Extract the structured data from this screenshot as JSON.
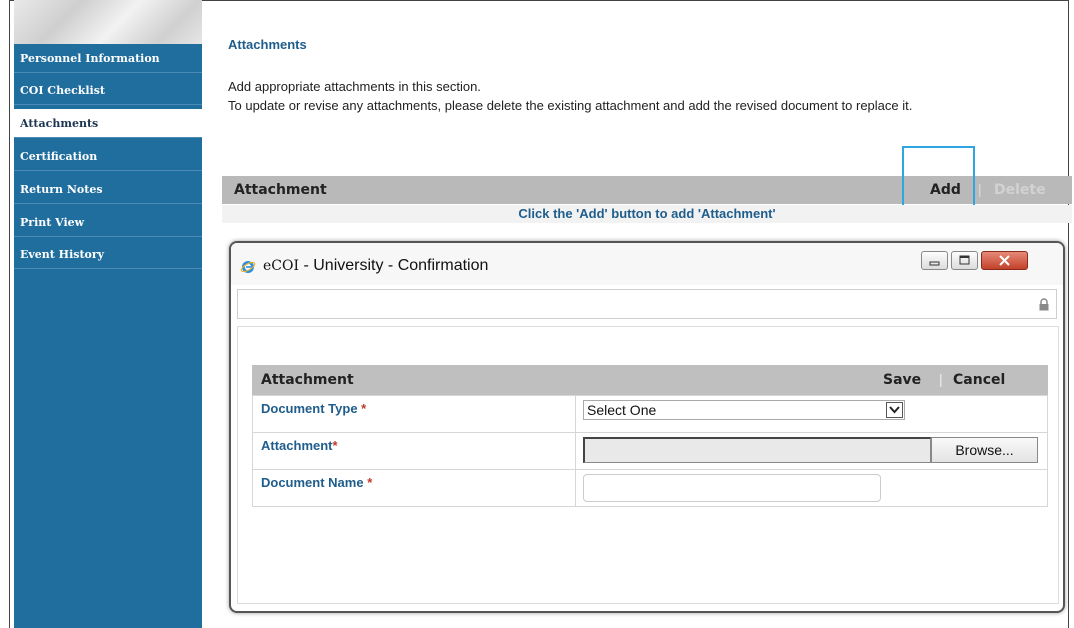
{
  "sidebar": {
    "items": [
      {
        "label": "Personnel Information"
      },
      {
        "label": "COI Checklist"
      },
      {
        "label": "Attachments",
        "active": true
      },
      {
        "label": "Certification"
      },
      {
        "label": "Return Notes"
      },
      {
        "label": "Print View"
      },
      {
        "label": "Event History"
      }
    ]
  },
  "main": {
    "section_title": "Attachments",
    "instruction_1": "Add appropriate attachments in this section.",
    "instruction_2": "To update or revise any attachments, please delete the existing attachment and add the revised document to replace it.",
    "attachment_bar": {
      "title": "Attachment",
      "add_label": "Add",
      "separator": "|",
      "delete_label": "Delete"
    },
    "empty_hint": "Click the 'Add' button to add 'Attachment'"
  },
  "popup": {
    "window_title_brand": "eCOI",
    "window_title_rest": " - University - Confirmation",
    "form": {
      "header_title": "Attachment",
      "save_label": "Save",
      "separator": "|",
      "cancel_label": "Cancel",
      "fields": [
        {
          "label": "Document Type",
          "required_marker": " *"
        },
        {
          "label": "Attachment",
          "required_marker": "*"
        },
        {
          "label": "Document Name",
          "required_marker": " *"
        }
      ],
      "document_type_selected": "Select One",
      "browse_label": "Browse...",
      "document_name_value": ""
    }
  },
  "colors": {
    "sidebar_bg": "#1f6e9e",
    "label_blue": "#1f5d8c",
    "required_red": "#c0392b",
    "highlight": "#2ea7e0"
  }
}
